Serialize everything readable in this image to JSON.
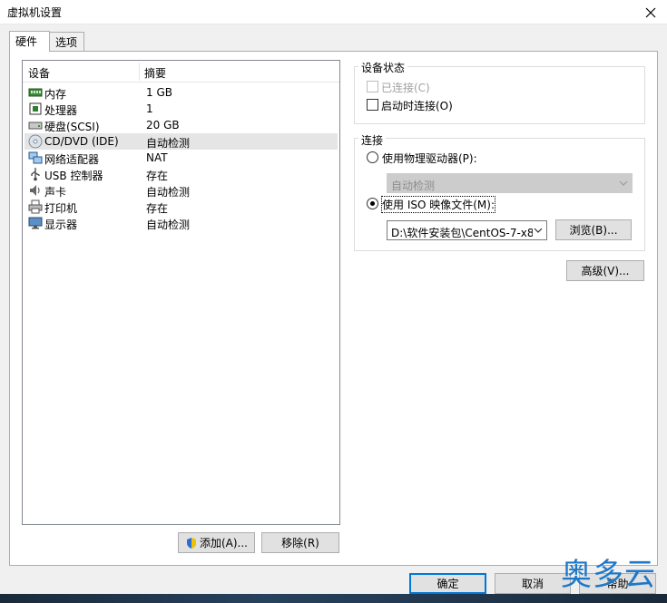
{
  "window": {
    "title": "虚拟机设置",
    "close_label": "✕"
  },
  "tabs": [
    {
      "label": "硬件",
      "active": true
    },
    {
      "label": "选项",
      "active": false
    }
  ],
  "device_list": {
    "columns": [
      "设备",
      "摘要"
    ],
    "rows": [
      {
        "name": "内存",
        "summary": "1 GB",
        "icon": "memory-icon"
      },
      {
        "name": "处理器",
        "summary": "1",
        "icon": "processor-icon"
      },
      {
        "name": "硬盘(SCSI)",
        "summary": "20 GB",
        "icon": "hard-disk-icon"
      },
      {
        "name": "CD/DVD (IDE)",
        "summary": "自动检测",
        "icon": "cd-dvd-icon",
        "selected": true
      },
      {
        "name": "网络适配器",
        "summary": "NAT",
        "icon": "network-adapter-icon"
      },
      {
        "name": "USB 控制器",
        "summary": "存在",
        "icon": "usb-icon"
      },
      {
        "name": "声卡",
        "summary": "自动检测",
        "icon": "sound-card-icon"
      },
      {
        "name": "打印机",
        "summary": "存在",
        "icon": "printer-icon"
      },
      {
        "name": "显示器",
        "summary": "自动检测",
        "icon": "display-icon"
      }
    ]
  },
  "list_buttons": {
    "add": "添加(A)...",
    "remove": "移除(R)"
  },
  "device_status": {
    "title": "设备状态",
    "connected": {
      "label": "已连接(C)",
      "checked": false,
      "disabled": true
    },
    "connect_at_power_on": {
      "label": "启动时连接(O)",
      "checked": false
    }
  },
  "connection": {
    "title": "连接",
    "physical_drive": {
      "label": "使用物理驱动器(P):",
      "selected": false
    },
    "physical_drive_combo": {
      "value": "自动检测",
      "disabled": true
    },
    "iso_image": {
      "label": "使用 ISO 映像文件(M):",
      "selected": true
    },
    "iso_path": {
      "value": "D:\\软件安装包\\CentOS-7-x8"
    },
    "browse_button": "浏览(B)..."
  },
  "advanced_button": "高级(V)...",
  "footer": {
    "ok": "确定",
    "cancel": "取消",
    "help": "帮助"
  },
  "watermark": "奥多云",
  "colors": {
    "accent": "#0078d7",
    "selection": "#e5e5e5",
    "watermark": "#1e78c8"
  }
}
